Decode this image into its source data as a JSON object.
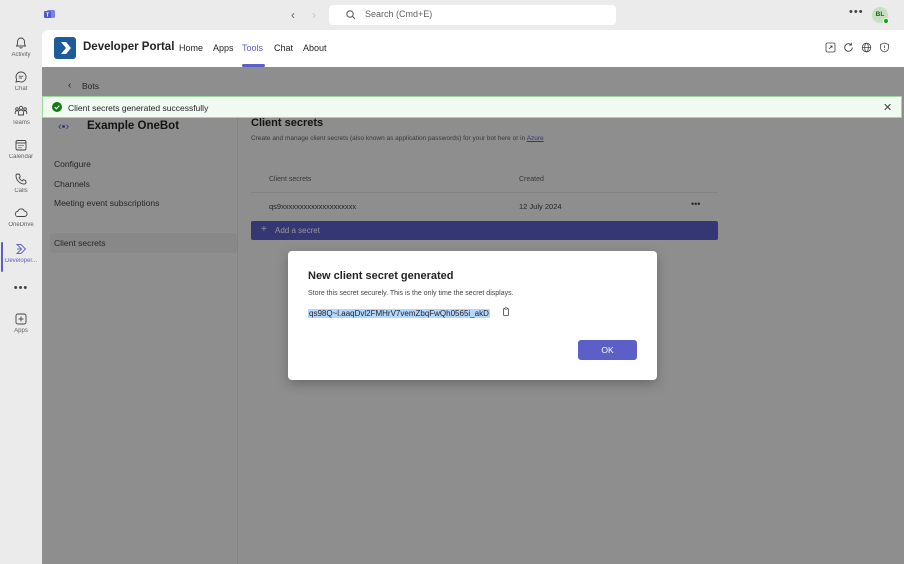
{
  "titlebar": {
    "search_placeholder": "Search (Cmd+E)",
    "avatar_initials": "BL"
  },
  "rail": {
    "items": [
      {
        "label": "Activity",
        "icon": "bell-icon"
      },
      {
        "label": "Chat",
        "icon": "chat-icon"
      },
      {
        "label": "Teams",
        "icon": "teams-icon"
      },
      {
        "label": "Calendar",
        "icon": "calendar-icon"
      },
      {
        "label": "Calls",
        "icon": "phone-icon"
      },
      {
        "label": "OneDrive",
        "icon": "cloud-icon"
      },
      {
        "label": "Developer...",
        "icon": "developer-portal-icon",
        "active": true
      },
      {
        "label": "Apps",
        "icon": "apps-icon"
      }
    ]
  },
  "app": {
    "name": "Developer Portal",
    "nav": [
      "Home",
      "Apps",
      "Tools",
      "Chat",
      "About"
    ],
    "active_nav": "Tools",
    "accent": "#5b5fc7"
  },
  "content": {
    "back_label": "Bots",
    "bot_name": "Example OneBot",
    "side_links": [
      "Configure",
      "Channels",
      "Meeting event subscriptions",
      "Client secrets"
    ],
    "active_side_link": "Client secrets",
    "section_title": "Client secrets",
    "section_desc": "Create and manage client secrets (also known as application passwords) for your bot here or in",
    "section_link": "Azure",
    "table": {
      "headers": [
        "Client secrets",
        "Created"
      ],
      "rows": [
        {
          "secret": "qs9xxxxxxxxxxxxxxxxxxxx",
          "created": "12 July 2024"
        }
      ]
    },
    "add_button": "Add a secret"
  },
  "toast": {
    "message": "Client secrets generated successfully",
    "color": "#107c10"
  },
  "dialog": {
    "title": "New client secret generated",
    "body": "Store this secret securely. This is the only time the secret displays.",
    "secret": "qs98Q~l.aaqDvl2FMHrV7vemZbqFwQh0565i_akD",
    "ok_label": "OK"
  }
}
